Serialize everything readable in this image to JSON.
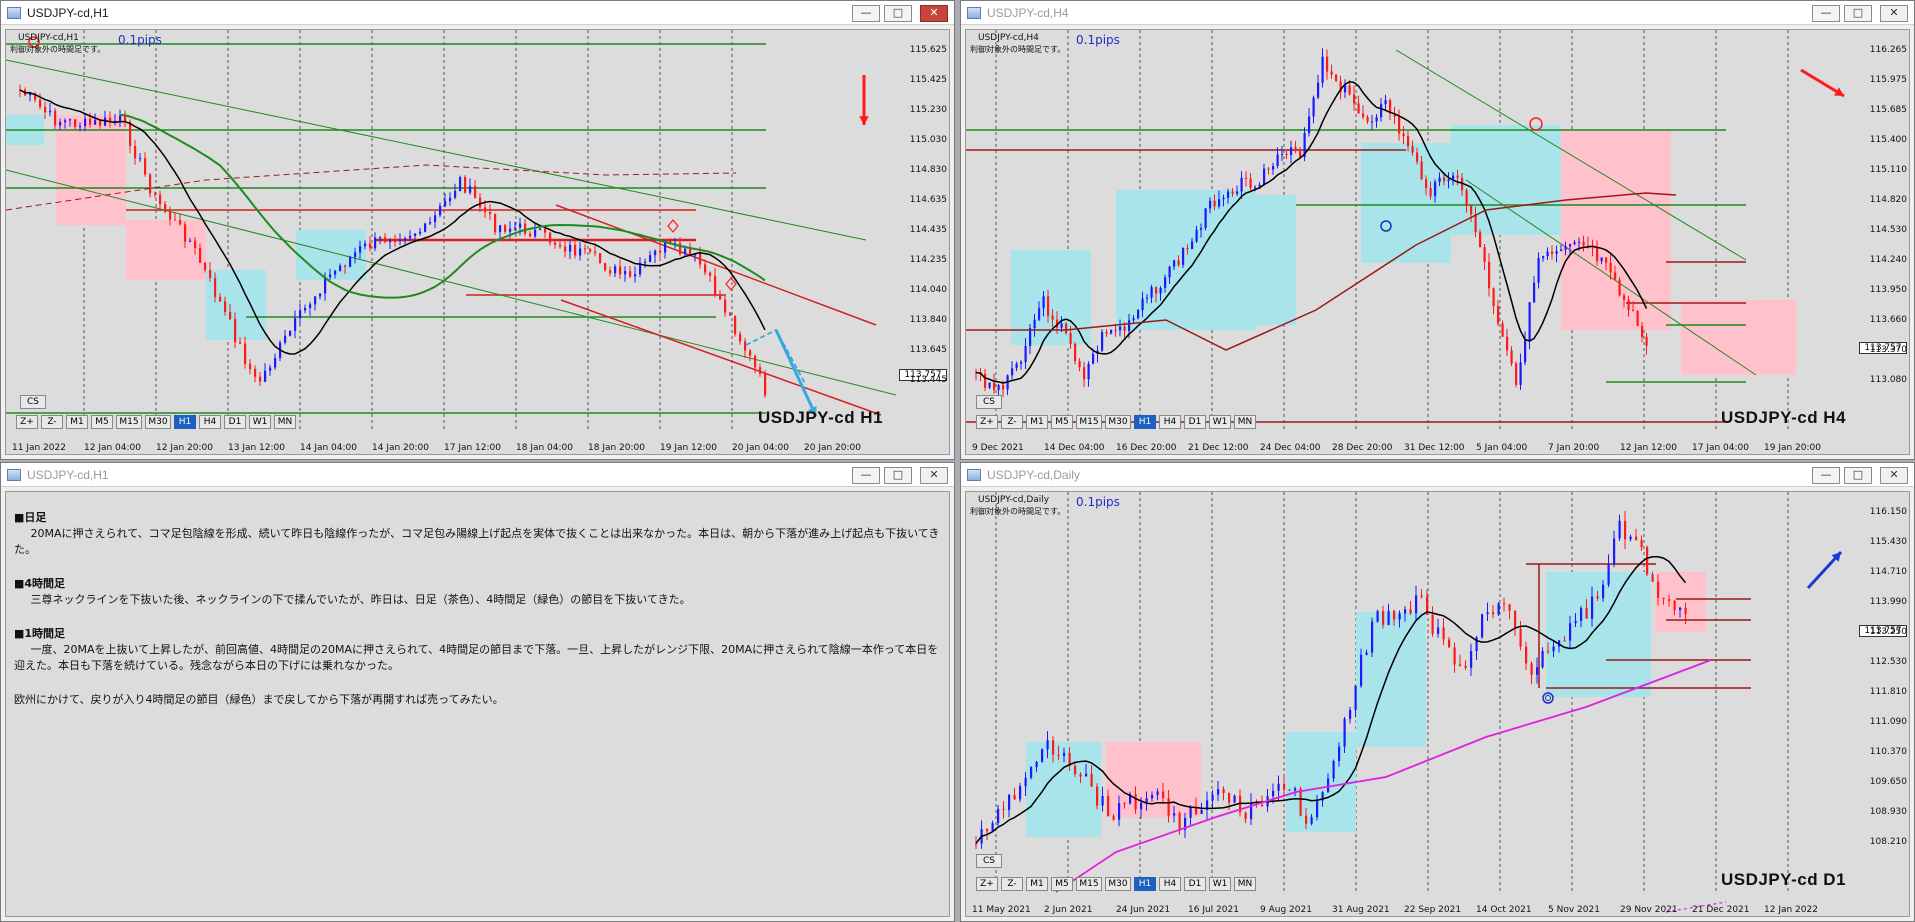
{
  "colors": {
    "bull": "#1a1aff",
    "bear": "#ff1a1a",
    "ma20": "#000000",
    "ma_green": "#1f8a1f",
    "ma_brown": "#9a1a1a",
    "ma_magenta": "#e020e0",
    "zone_pink": "#ffc2cc",
    "zone_cyan": "#a8e4ea",
    "level_red": "#d42020",
    "level_green": "#1f8a1f"
  },
  "windows": {
    "h1": {
      "title": "USDJPY-cd,H1",
      "symbol_label": "USDJPY-cd,H1",
      "pips": "0.1pips",
      "note": "利御対象外の時間足です。",
      "big_label": "USDJPY-cd H1",
      "current_price": "113.757",
      "y_labels": [
        "115.625",
        "115.425",
        "115.230",
        "115.030",
        "114.830",
        "114.635",
        "114.435",
        "114.235",
        "114.040",
        "113.840",
        "113.645",
        "113.445"
      ],
      "x_labels": [
        "11 Jan 2022",
        "12 Jan 04:00",
        "12 Jan 20:00",
        "13 Jan 12:00",
        "14 Jan 04:00",
        "14 Jan 20:00",
        "17 Jan 12:00",
        "18 Jan 04:00",
        "18 Jan 20:00",
        "19 Jan 12:00",
        "20 Jan 04:00",
        "20 Jan 20:00"
      ],
      "cs_label": "CS",
      "timeframes": [
        "Z+",
        "Z-",
        "M1",
        "M5",
        "M15",
        "M30",
        "H1",
        "H4",
        "D1",
        "W1",
        "MN"
      ],
      "selected_tf": "H1"
    },
    "h4": {
      "title": "USDJPY-cd,H4",
      "symbol_label": "USDJPY-cd,H4",
      "pips": "0.1pips",
      "note": "利御対象外の時間足です。",
      "big_label": "USDJPY-cd H4",
      "current_price": "113.757",
      "y_labels": [
        "116.265",
        "115.975",
        "115.685",
        "115.400",
        "115.110",
        "114.820",
        "114.530",
        "114.240",
        "113.950",
        "113.660",
        "113.370",
        "113.080"
      ],
      "x_labels": [
        "9 Dec 2021",
        "14 Dec 04:00",
        "16 Dec 20:00",
        "21 Dec 12:00",
        "24 Dec 04:00",
        "28 Dec 20:00",
        "31 Dec 12:00",
        "5 Jan 04:00",
        "7 Jan 20:00",
        "12 Jan 12:00",
        "17 Jan 04:00",
        "19 Jan 20:00"
      ],
      "cs_label": "CS",
      "timeframes": [
        "Z+",
        "Z-",
        "M1",
        "M5",
        "M15",
        "M30",
        "H1",
        "H4",
        "D1",
        "W1",
        "MN"
      ],
      "selected_tf": "H1"
    },
    "daily": {
      "title": "USDJPY-cd,Daily",
      "symbol_label": "USDJPY-cd,Daily",
      "pips": "0.1pips",
      "note": "利御対象外の時間足です。",
      "big_label": "USDJPY-cd D1",
      "current_price": "113.757",
      "y_labels": [
        "116.150",
        "115.430",
        "114.710",
        "113.990",
        "113.250",
        "112.530",
        "111.810",
        "111.090",
        "110.370",
        "109.650",
        "108.930",
        "108.210"
      ],
      "x_labels": [
        "11 May 2021",
        "2 Jun 2021",
        "24 Jun 2021",
        "16 Jul 2021",
        "9 Aug 2021",
        "31 Aug 2021",
        "22 Sep 2021",
        "14 Oct 2021",
        "5 Nov 2021",
        "29 Nov 2021",
        "21 Dec 2021",
        "12 Jan 2022"
      ],
      "cs_label": "CS",
      "timeframes": [
        "Z+",
        "Z-",
        "M1",
        "M5",
        "M15",
        "M30",
        "H1",
        "H4",
        "D1",
        "W1",
        "MN"
      ],
      "selected_tf": "H1"
    },
    "text": {
      "title": "USDJPY-cd,H1",
      "sections": [
        {
          "heading": "■日足",
          "body": "20MAに押さえられて、コマ足包陰線を形成、続いて昨日も陰線作ったが、コマ足包み陽線上げ起点を実体で抜くことは出来なかった。本日は、朝から下落が進み上げ起点も下抜いてきた。"
        },
        {
          "heading": "■4時間足",
          "body": "三尊ネックラインを下抜いた後、ネックラインの下で揉んでいたが、昨日は、日足（茶色）、4時間足（緑色）の節目を下抜いてきた。"
        },
        {
          "heading": "■1時間足",
          "body": "一度、20MAを上抜いて上昇したが、前回高値、4時間足の20MAに押さえられて、4時間足の節目まで下落。一旦、上昇したがレンジ下限、20MAに押さえられて陰線一本作って本日を迎えた。本日も下落を続けている。残念ながら本日の下げには乗れなかった。"
        },
        {
          "heading": "",
          "body": "欧州にかけて、戻りが入り4時間足の節目（緑色）まで戻してから下落が再開すれば売ってみたい。"
        }
      ]
    }
  }
}
